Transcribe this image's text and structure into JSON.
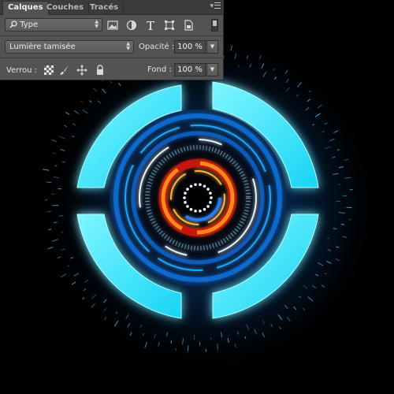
{
  "panel": {
    "tabs": [
      {
        "label": "Calques",
        "active": true
      },
      {
        "label": "Couches",
        "active": false
      },
      {
        "label": "Tracés",
        "active": false
      }
    ],
    "menu_glyph": "▾",
    "filter": {
      "value": "Type"
    },
    "filter_icons": [
      "image-filter-icon",
      "adjustment-filter-icon",
      "text-filter-icon",
      "shape-filter-icon",
      "smart-object-filter-icon"
    ],
    "blend_mode": "Lumière tamisée",
    "opacity": {
      "label": "Opacité :",
      "value": "100 %"
    },
    "lock": {
      "label": "Verrou :",
      "icons": [
        "lock-transparent-pixels-icon",
        "lock-image-pixels-icon",
        "lock-position-icon",
        "lock-all-icon"
      ]
    },
    "fill": {
      "label": "Fond :",
      "value": "100 %"
    }
  },
  "artwork": {
    "description_colors": {
      "background": "#000000",
      "cyan": "#27e6ff",
      "blue": "#0a6fd8",
      "orange": "#ff7a1a",
      "red": "#d81a10"
    }
  }
}
